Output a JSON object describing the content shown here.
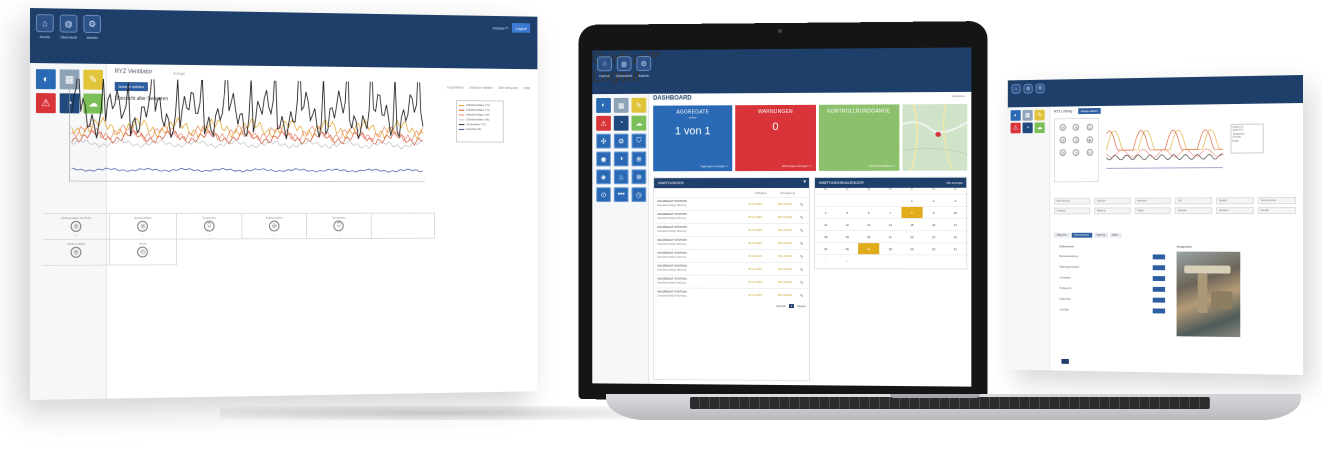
{
  "nav": {
    "items": [
      {
        "icon": "home-icon",
        "glyph": "⌂",
        "label": "Home"
      },
      {
        "icon": "globe-icon",
        "glyph": "◍",
        "label": "Übersicht"
      },
      {
        "icon": "settings-icon",
        "glyph": "⚙",
        "label": "Admin"
      }
    ],
    "user_label": "Ovidius™",
    "login_label": "Logout"
  },
  "left_screen": {
    "title": "RYZ Ventilator",
    "subtitle": "Anlage",
    "select_label": "Anlage wählen",
    "section_title": "Übersicht aller Sensoren",
    "links": [
      "Exportieren",
      "Zeitraum wählen",
      "Alle Sensoren",
      "Hilfe"
    ],
    "legend": [
      {
        "name": "Abluftventilator (°C)",
        "color": "#e0a020"
      },
      {
        "name": "Zuluftventilator (°C)",
        "color": "#d24a2a"
      },
      {
        "name": "Abluftventilator (%)",
        "color": "#e8846a"
      },
      {
        "name": "Zuluftventilator (%)",
        "color": "#c0c0c0"
      },
      {
        "name": "Temperatur (°C)",
        "color": "#222222"
      },
      {
        "name": "Feuchte (%)",
        "color": "#4050a0"
      }
    ],
    "sensors": [
      {
        "label": "Abluftventilator Drehzahl",
        "glyph": "◎",
        "value": "—"
      },
      {
        "label": "Zuluftventilator",
        "glyph": "◎",
        "value": "—"
      },
      {
        "label": "Temperatur",
        "glyph": "⬯",
        "value": "—"
      },
      {
        "label": "Zuluftventilator",
        "glyph": "◎",
        "value": "—"
      },
      {
        "label": "Temperatur",
        "glyph": "⬯",
        "value": "—"
      },
      {
        "label": "",
        "glyph": "",
        "value": ""
      },
      {
        "label": "Abluftventilator",
        "glyph": "◎",
        "value": "—"
      },
      {
        "label": "Druck",
        "glyph": "◴",
        "value": "—"
      }
    ]
  },
  "laptop": {
    "dashboard_title": "DASHBOARD",
    "dashboard_link": "Anpassen",
    "cards": [
      {
        "title": "AGGREGATE",
        "sub": "online",
        "big": "1 von 1",
        "foot": "Aggregate anzeigen ↗",
        "color": "#2a6ab5"
      },
      {
        "title": "WARNUNGEN",
        "sub": "",
        "big": "0",
        "foot": "Warnungen anzeigen ↗",
        "color": "#d8343a"
      },
      {
        "title": "KONTROLLRUNDGÄNGE",
        "sub": "",
        "big": "",
        "foot": "Kontrollrundgänge ↗",
        "color": "#8cc06c"
      }
    ],
    "wartungen": {
      "title": "WARTUNGEN",
      "col1": "Fälligkeit",
      "col2": "Erledigung",
      "rows": [
        {
          "name": "AGGREGAT STATION",
          "desc": "Standardmäßige Wartung",
          "d1": "06.11.2020",
          "d2": "06.11.2020"
        },
        {
          "name": "AGGREGAT STATION",
          "desc": "Standardmäßige Wartung",
          "d1": "06.11.2020",
          "d2": "06.11.2020"
        },
        {
          "name": "AGGREGAT STATION",
          "desc": "Standardmäßige Wartung",
          "d1": "06.11.2020",
          "d2": "06.11.2020"
        },
        {
          "name": "AGGREGAT STATION",
          "desc": "Standardmäßige Wartung",
          "d1": "06.11.2020",
          "d2": "06.11.2020"
        },
        {
          "name": "AGGREGAT STATION",
          "desc": "Standardmäßige Wartung",
          "d1": "06.11.2020",
          "d2": "06.11.2020"
        },
        {
          "name": "AGGREGAT STATION",
          "desc": "Standardmäßige Wartung",
          "d1": "06.11.2020",
          "d2": "06.11.2020"
        },
        {
          "name": "AGGREGAT STATION",
          "desc": "Standardmäßige Wartung",
          "d1": "06.11.2020",
          "d2": "06.11.2020"
        },
        {
          "name": "AGGREGAT STATION",
          "desc": "Standardmäßige Wartung",
          "d1": "06.11.2020",
          "d2": "06.11.2020"
        }
      ],
      "pager": [
        "Zurück",
        "1",
        "Weiter"
      ]
    },
    "kalender": {
      "title": "WARTUNGSKALENDER",
      "link": "Alle anzeigen",
      "dow": [
        "Mo",
        "Di",
        "Mi",
        "Do",
        "Fr",
        "Sa",
        "So"
      ],
      "days": [
        {
          "d": "",
          "hl": false
        },
        {
          "d": "",
          "hl": false
        },
        {
          "d": "",
          "hl": false
        },
        {
          "d": "",
          "hl": false
        },
        {
          "d": "1",
          "hl": false
        },
        {
          "d": "2",
          "hl": false
        },
        {
          "d": "3",
          "hl": false
        },
        {
          "d": "4",
          "hl": false
        },
        {
          "d": "5",
          "hl": false
        },
        {
          "d": "6",
          "hl": false
        },
        {
          "d": "7",
          "hl": false
        },
        {
          "d": "8",
          "hl": true
        },
        {
          "d": "9",
          "hl": false
        },
        {
          "d": "10",
          "hl": false
        },
        {
          "d": "11",
          "hl": false
        },
        {
          "d": "12",
          "hl": false
        },
        {
          "d": "13",
          "hl": false
        },
        {
          "d": "14",
          "hl": false
        },
        {
          "d": "15",
          "hl": false
        },
        {
          "d": "16",
          "hl": false
        },
        {
          "d": "17",
          "hl": false
        },
        {
          "d": "18",
          "hl": false
        },
        {
          "d": "19",
          "hl": false
        },
        {
          "d": "20",
          "hl": false
        },
        {
          "d": "21",
          "hl": false
        },
        {
          "d": "22",
          "hl": false
        },
        {
          "d": "23",
          "hl": false
        },
        {
          "d": "24",
          "hl": false
        },
        {
          "d": "25",
          "hl": false
        },
        {
          "d": "26",
          "hl": false
        },
        {
          "d": "27",
          "hl": true
        },
        {
          "d": "28",
          "hl": false
        },
        {
          "d": "29",
          "hl": false
        },
        {
          "d": "30",
          "hl": false
        },
        {
          "d": "31",
          "hl": false
        },
        {
          "d": "1",
          "hl": false
        },
        {
          "d": "2",
          "hl": false
        },
        {
          "d": "",
          "hl": false
        },
        {
          "d": "",
          "hl": false
        },
        {
          "d": "",
          "hl": false
        },
        {
          "d": "",
          "hl": false
        },
        {
          "d": "",
          "hl": false
        }
      ]
    }
  },
  "right_screen": {
    "title": "RYZ Lüftung",
    "title_btn": "Anlage wählen",
    "legend": [
      "Abluft (°C)",
      "Zuluft (°C)",
      "Temperatur",
      "Feuchte",
      "Druck"
    ],
    "fields": [
      "Bezeichnung",
      "Standort",
      "Hersteller",
      "Typ",
      "Baujahr",
      "Seriennummer",
      "Leistung",
      "Wartung",
      "Status",
      "Intervall",
      "Betreiber",
      "Kontakt"
    ],
    "tabs": [
      "Allgemein",
      "Dokumentation",
      "Wartung",
      "Bilder"
    ],
    "list_title": "Dokumente",
    "list_items": [
      "Betriebsanleitung",
      "Wartungsprotokoll",
      "Schaltplan",
      "Prüfbericht",
      "Datenblatt",
      "Zertifikat"
    ],
    "photo_title": "Anlagenbild"
  }
}
